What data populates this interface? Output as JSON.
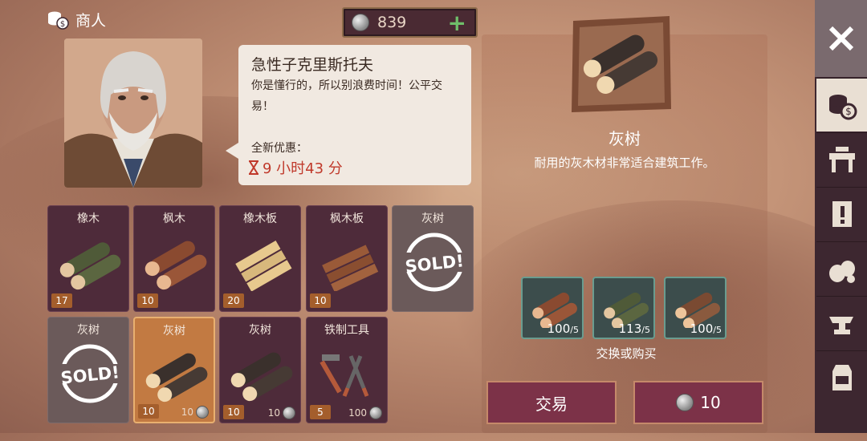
{
  "header": {
    "title": "商人",
    "icon": "coins-icon"
  },
  "currency": {
    "amount": "839",
    "add_icon": "plus-icon"
  },
  "merchant": {
    "name": "急性子克里斯托夫",
    "message": "你是懂行的，所以别浪费时间！公平交易！",
    "offer_label": "全新优惠：",
    "timer": "9 小时43 分"
  },
  "inventory": [
    {
      "title": "橡木",
      "qty": "17",
      "price": "",
      "state": "normal",
      "icon": "oak-log-icon"
    },
    {
      "title": "枫木",
      "qty": "10",
      "price": "",
      "state": "normal",
      "icon": "maple-log-icon"
    },
    {
      "title": "橡木板",
      "qty": "20",
      "price": "",
      "state": "normal",
      "icon": "oak-plank-icon"
    },
    {
      "title": "枫木板",
      "qty": "10",
      "price": "",
      "state": "normal",
      "icon": "maple-plank-icon"
    },
    {
      "title": "灰树",
      "qty": "",
      "price": "",
      "state": "sold",
      "icon": "ash-log-icon"
    },
    {
      "title": "灰树",
      "qty": "",
      "price": "",
      "state": "sold",
      "icon": "ash-log-icon"
    },
    {
      "title": "灰树",
      "qty": "10",
      "price": "10",
      "state": "selected",
      "icon": "ash-log-icon"
    },
    {
      "title": "灰树",
      "qty": "10",
      "price": "10",
      "state": "normal",
      "icon": "ash-log-icon"
    },
    {
      "title": "铁制工具",
      "qty": "5",
      "price": "100",
      "state": "normal",
      "icon": "iron-tools-icon"
    }
  ],
  "sold_stamp": "SOLD!",
  "detail": {
    "name": "灰树",
    "description": "耐用的灰木材非常适合建筑工作。",
    "requirements": [
      {
        "have": "100",
        "need": "5",
        "icon": "maple-log-icon"
      },
      {
        "have": "113",
        "need": "5",
        "icon": "oak-log-icon"
      },
      {
        "have": "100",
        "need": "5",
        "icon": "log-icon"
      }
    ],
    "exchange_label": "交换或购买",
    "trade_button": "交易",
    "buy_price": "10"
  },
  "sidebar": {
    "close_icon": "close-icon",
    "tabs": [
      "coins-icon",
      "workbench-icon",
      "quest-icon",
      "sacks-icon",
      "anvil-icon",
      "backpack-icon"
    ],
    "active_tab": 0
  },
  "colors": {
    "slot_bg": "#4e2b3a",
    "slot_selected": "#c27a42",
    "button_bg": "#7c3248",
    "timer_red": "#c0392b",
    "sidebar_bg": "#3d2730"
  }
}
